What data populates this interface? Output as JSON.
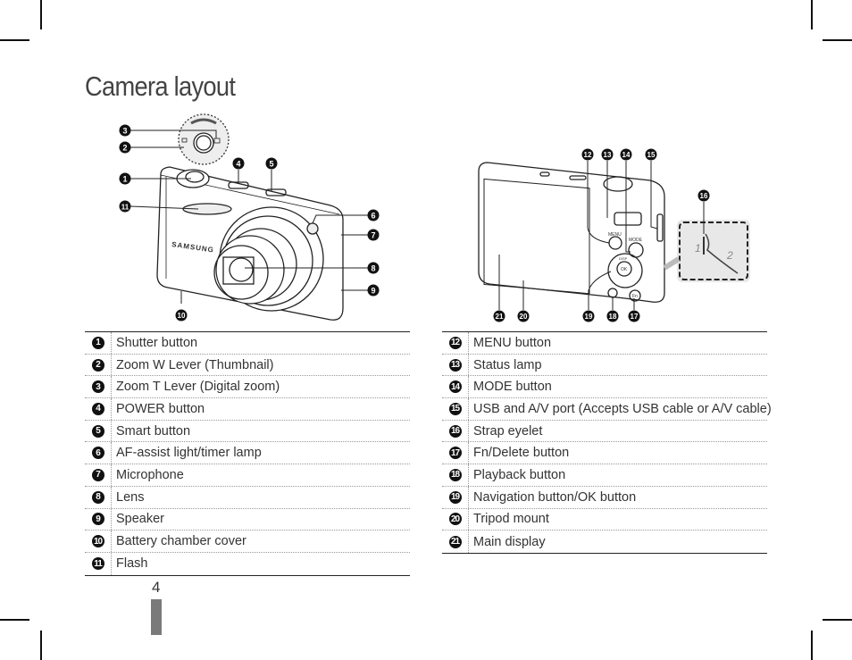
{
  "page": {
    "title": "Camera layout",
    "page_number": "4"
  },
  "front_view": {
    "brand_text": "SAMSUNG",
    "callouts": [
      "1",
      "2",
      "3",
      "4",
      "5",
      "6",
      "7",
      "8",
      "9",
      "10",
      "11"
    ]
  },
  "back_view": {
    "button_labels": {
      "menu": "MENU",
      "mode": "MODE",
      "ok": "OK",
      "disp": "DISP",
      "fn": "Fn"
    },
    "strap_steps": [
      "1",
      "2"
    ],
    "callouts": [
      "12",
      "13",
      "14",
      "15",
      "16",
      "17",
      "18",
      "19",
      "20",
      "21"
    ]
  },
  "front_table": [
    {
      "num": "1",
      "label": "Shutter button"
    },
    {
      "num": "2",
      "label": "Zoom W Lever (Thumbnail)"
    },
    {
      "num": "3",
      "label": "Zoom T Lever (Digital zoom)"
    },
    {
      "num": "4",
      "label": "POWER button"
    },
    {
      "num": "5",
      "label": "Smart button"
    },
    {
      "num": "6",
      "label": "AF-assist light/timer lamp"
    },
    {
      "num": "7",
      "label": "Microphone"
    },
    {
      "num": "8",
      "label": "Lens"
    },
    {
      "num": "9",
      "label": "Speaker"
    },
    {
      "num": "10",
      "label": "Battery chamber cover"
    },
    {
      "num": "11",
      "label": "Flash"
    }
  ],
  "back_table": [
    {
      "num": "12",
      "label": "MENU button"
    },
    {
      "num": "13",
      "label": "Status lamp"
    },
    {
      "num": "14",
      "label": "MODE button"
    },
    {
      "num": "15",
      "label": "USB and A/V port (Accepts USB cable or A/V cable)"
    },
    {
      "num": "16",
      "label": "Strap eyelet"
    },
    {
      "num": "17",
      "label": "Fn/Delete button"
    },
    {
      "num": "18",
      "label": "Playback button"
    },
    {
      "num": "19",
      "label": "Navigation button/OK button"
    },
    {
      "num": "20",
      "label": "Tripod mount"
    },
    {
      "num": "21",
      "label": "Main display"
    }
  ]
}
